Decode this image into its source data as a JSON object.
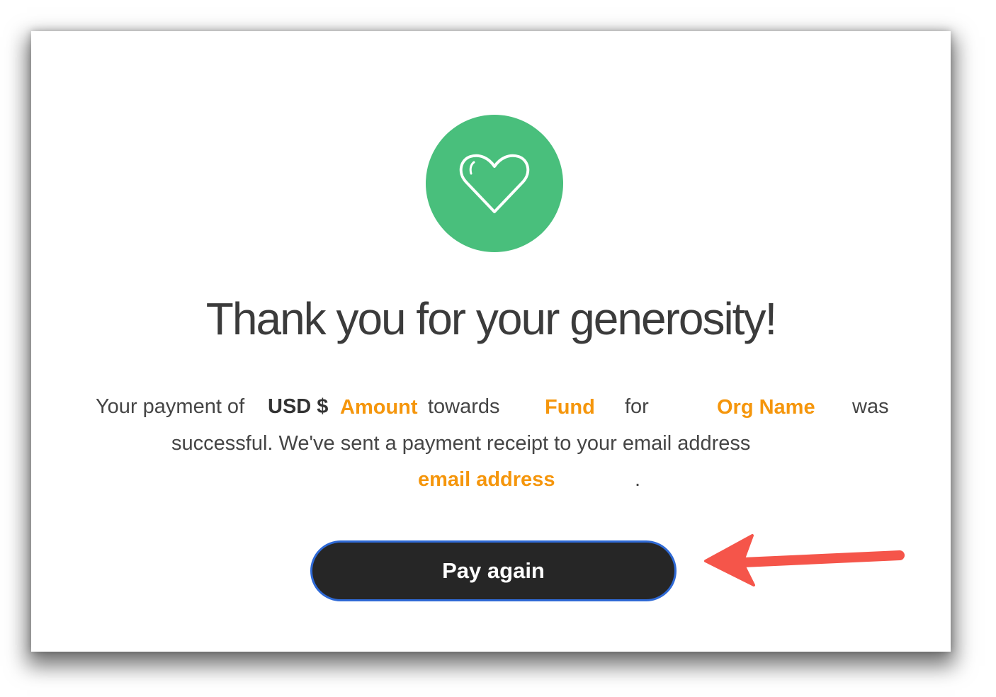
{
  "card": {
    "icon": "heart-icon",
    "badge_color": "#49bf7c",
    "title": "Thank you for your generosity!",
    "message": {
      "prefix": "Your payment of",
      "currency": "USD $",
      "amount": "Amount",
      "towards": "towards",
      "fund": "Fund",
      "for": "for",
      "org_name": "Org Name",
      "was": "was",
      "line2": "successful. We've sent a payment receipt to your email address",
      "email": "email address",
      "period": "."
    },
    "highlight_color": "#f5960c",
    "button": {
      "label": "Pay again"
    }
  },
  "annotation": {
    "icon": "red-arrow-icon",
    "color": "#f5554a"
  }
}
